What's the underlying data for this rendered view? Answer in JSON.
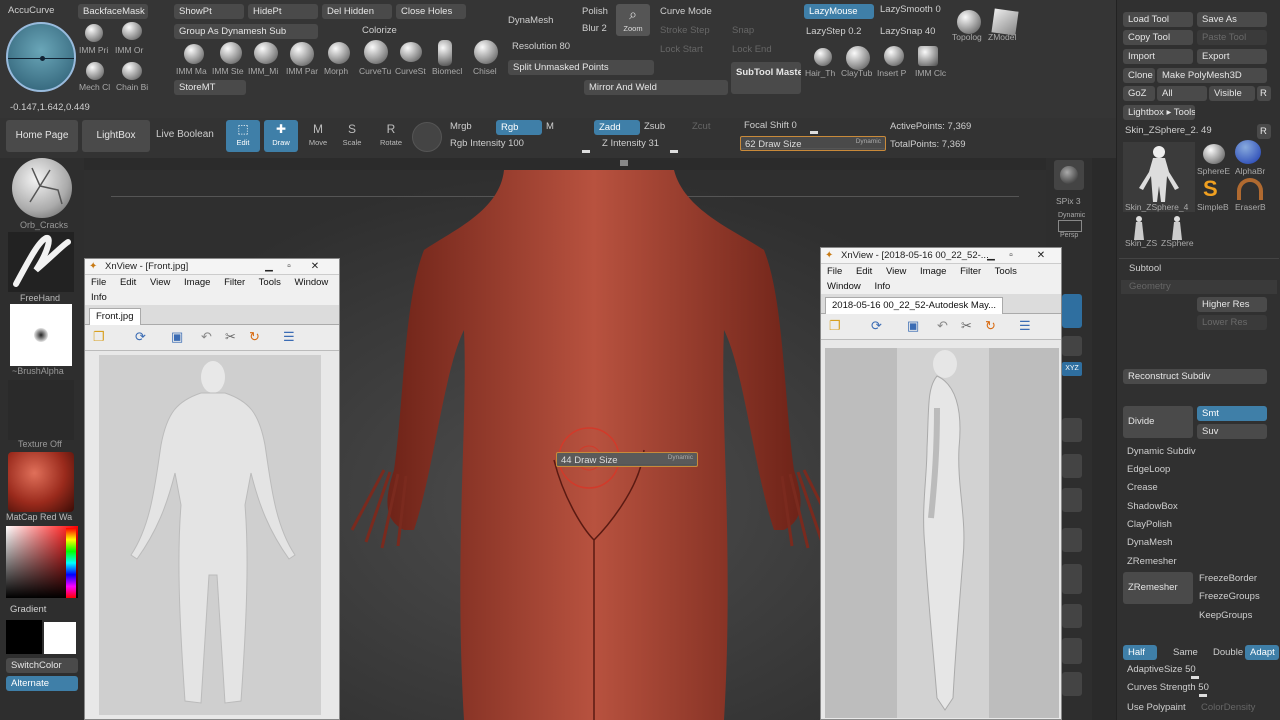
{
  "topbar": {
    "accucurve": "AccuCurve",
    "backfacemask": "BackfaceMask",
    "coords": "-0.147,1.642,0.449",
    "brushes": [
      "IMM Pri",
      "IMM Or",
      "Mech Cl",
      "Chain Bi",
      "IMM Ma",
      "IMM Ste",
      "IMM_Mi",
      "IMM Par",
      "Morph",
      "CurveTu",
      "CurveSt",
      "Biomecl",
      "Chisel"
    ],
    "showpt": "ShowPt",
    "hidept": "HidePt",
    "delhidden": "Del Hidden",
    "closeholes": "Close Holes",
    "colorize": "Colorize",
    "group_as_dynamesh": "Group As Dynamesh Sub",
    "storemt": "StoreMT",
    "dynamesh": "DynaMesh",
    "polish": "Polish",
    "blur": "Blur 2",
    "zoom": "Zoom",
    "resolution": "Resolution 80",
    "split_unmasked": "Split Unmasked Points",
    "curve_mode": "Curve Mode",
    "mirror_weld": "Mirror And Weld",
    "subtool_master": "SubTool Master",
    "lazymouse": "LazyMouse",
    "lazysmooth": "LazySmooth 0",
    "lazystep": "LazyStep 0.2",
    "lazysnap": "LazySnap 40",
    "hair": "Hair_Th",
    "claytub": "ClayTub",
    "insertp": "Insert P",
    "immclc": "IMM Clc",
    "topolog": "Topolog",
    "zmodeler": "ZModel"
  },
  "toolbar2": {
    "home_page": "Home Page",
    "lightbox": "LightBox",
    "live_boolean": "Live Boolean",
    "edit": "Edit",
    "draw": "Draw",
    "move": "Move",
    "scale": "Scale",
    "rotate": "Rotate",
    "mrgb": "Mrgb",
    "rgb": "Rgb",
    "m": "M",
    "zadd": "Zadd",
    "zsub": "Zsub",
    "zcut": "Zcut",
    "rgb_intensity": "Rgb Intensity 100",
    "z_intensity": "Z Intensity 31",
    "focal_shift": "Focal Shift 0",
    "draw_size": "62 Draw Size",
    "dynamic": "Dynamic",
    "active_points": "ActivePoints: 7,369",
    "total_points": "TotalPoints: 7,369"
  },
  "leftshelf": {
    "orb_cracks": "Orb_Cracks",
    "freehand": "FreeHand",
    "brushalpha": "~BrushAlpha",
    "texture_off": "Texture Off",
    "matcap": "MatCap Red Wa",
    "gradient": "Gradient",
    "switchcolor": "SwitchColor",
    "alternate": "Alternate"
  },
  "rightshelf": {
    "spix": "SPix 3",
    "dynamic": "Dynamic",
    "persp": "Persp",
    "xyz": "XYZ"
  },
  "viewport": {
    "draw_size_popup": "44 Draw Size",
    "popup_dynamic": "Dynamic"
  },
  "xview_front": {
    "title": "XnView - [Front.jpg]",
    "menu": [
      "File",
      "Edit",
      "View",
      "Image",
      "Filter",
      "Tools",
      "Window"
    ],
    "menu2": "Info",
    "tab": "Front.jpg"
  },
  "xview_side": {
    "title": "XnView - [2018-05-16 00_22_52-...",
    "menu": [
      "File",
      "Edit",
      "View",
      "Image",
      "Filter",
      "Tools"
    ],
    "menu2": [
      "Window",
      "Info"
    ],
    "tab": "2018-05-16 00_22_52-Autodesk May..."
  },
  "rightpanel": {
    "load_tool": "Load Tool",
    "save_as": "Save As",
    "copy_tool": "Copy Tool",
    "paste_tool": "Paste Tool",
    "import": "Import",
    "export": "Export",
    "clone": "Clone",
    "make_polymesh": "Make PolyMesh3D",
    "goz": "GoZ",
    "all": "All",
    "visible": "Visible",
    "r": "R",
    "lightbox_tools": "Lightbox ▸ Tools",
    "skin_zsphere_val": "Skin_ZSphere_2. 49",
    "tools": [
      "Skin_ZSphere_4",
      "SphereE",
      "AlphaBr",
      "SimpleB",
      "EraserB",
      "Skin_ZS",
      "ZSphere"
    ],
    "subtool": "Subtool",
    "geometry": "Geometry",
    "higher_res": "Higher Res",
    "lower_res": "Lower Res",
    "reconstruct_subdiv": "Reconstruct Subdiv",
    "divide": "Divide",
    "smt": "Smt",
    "suv": "Suv",
    "dynamic_subdiv": "Dynamic Subdiv",
    "edgeloop": "EdgeLoop",
    "crease": "Crease",
    "shadowbox": "ShadowBox",
    "claypolish": "ClayPolish",
    "dynamesh": "DynaMesh",
    "zremesher_title": "ZRemesher",
    "zremesher": "ZRemesher",
    "freezeborder": "FreezeBorder",
    "freezegroups": "FreezeGroups",
    "keepgroups": "KeepGroups",
    "half": "Half",
    "same": "Same",
    "double": "Double",
    "adapt": "Adapt",
    "adaptive_size": "AdaptiveSize 50",
    "curves_strength": "Curves Strength 50",
    "use_polypaint": "Use Polypaint",
    "color_density": "ColorDensity"
  }
}
